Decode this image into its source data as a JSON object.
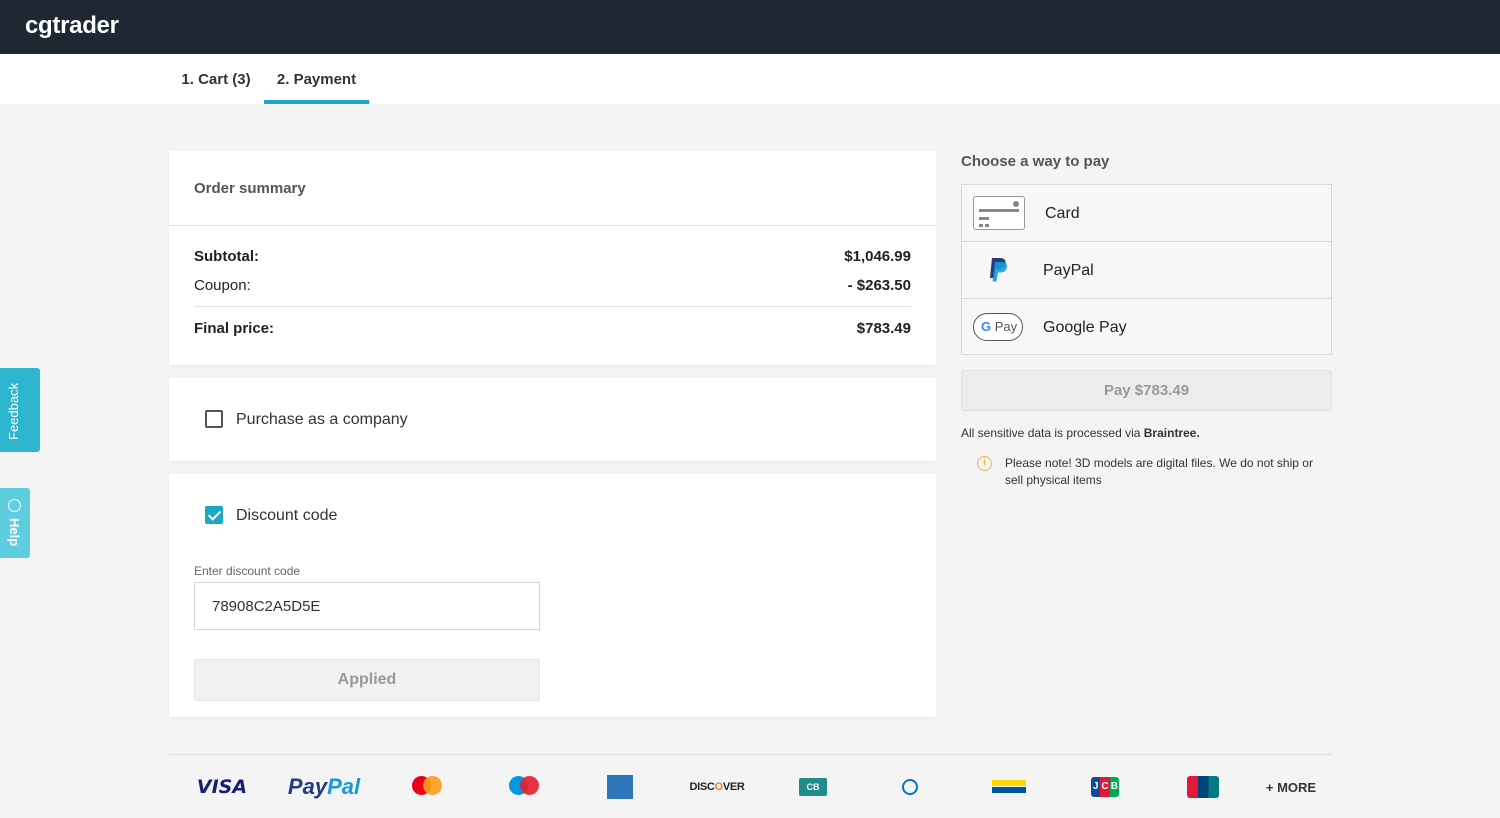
{
  "header": {
    "logo": "cgtrader"
  },
  "steps": [
    {
      "label": "1. Cart (3)",
      "active": false
    },
    {
      "label": "2. Payment",
      "active": true
    }
  ],
  "order_summary": {
    "title": "Order summary",
    "subtotal_label": "Subtotal:",
    "subtotal_value": "$1,046.99",
    "coupon_label": "Coupon:",
    "coupon_value": "- $263.50",
    "final_label": "Final price:",
    "final_value": "$783.49"
  },
  "company": {
    "label": "Purchase as a company",
    "checked": false
  },
  "discount": {
    "label": "Discount code",
    "checked": true,
    "field_label": "Enter discount code",
    "value": "78908C2A5D5E",
    "button": "Applied"
  },
  "payment": {
    "title": "Choose a way to pay",
    "methods": [
      {
        "label": "Card",
        "icon": "credit-card-icon"
      },
      {
        "label": "PayPal",
        "icon": "paypal-icon"
      },
      {
        "label": "Google Pay",
        "icon": "google-pay-icon"
      }
    ],
    "google_pay_badge": "Pay",
    "pay_button": "Pay $783.49",
    "sensitive_prefix": "All sensitive data is processed via ",
    "sensitive_brand": "Braintree.",
    "note": "Please note! 3D models are digital files. We do not ship or sell physical items"
  },
  "brands": {
    "visa": "VISA",
    "paypal_a": "Pay",
    "paypal_b": "Pal",
    "discover_a": "DISC",
    "discover_b": "O",
    "discover_c": "VER",
    "cb": "CB",
    "more": "+ MORE"
  },
  "side": {
    "feedback": "Feedback",
    "help": "Help"
  },
  "colors": {
    "accent": "#19a8c5",
    "topbar": "#1e2833",
    "feedback": "#2eb6cf",
    "help": "#5fcde0"
  }
}
